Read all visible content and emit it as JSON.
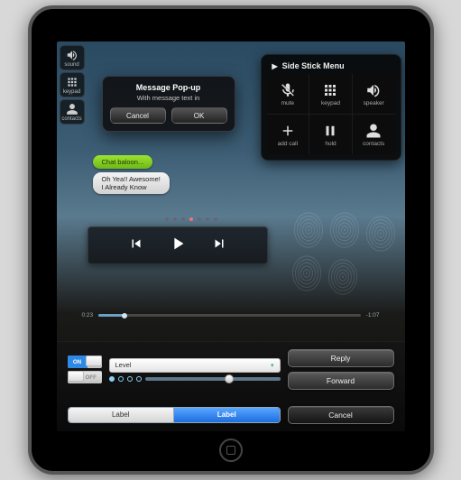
{
  "status": {
    "time": ""
  },
  "sidebar": {
    "items": [
      {
        "label": "sound",
        "icon": "volume-icon"
      },
      {
        "label": "keypad",
        "icon": "keypad-icon"
      },
      {
        "label": "contacts",
        "icon": "person-icon"
      }
    ]
  },
  "menu": {
    "title": "Side Stick Menu",
    "items": [
      {
        "label": "mute",
        "icon": "mic-off-icon"
      },
      {
        "label": "keypad",
        "icon": "keypad-icon"
      },
      {
        "label": "speaker",
        "icon": "volume-icon"
      },
      {
        "label": "add call",
        "icon": "plus-icon"
      },
      {
        "label": "hold",
        "icon": "pause-icon"
      },
      {
        "label": "contacts",
        "icon": "person-icon"
      }
    ]
  },
  "popup": {
    "title": "Message Pop-up",
    "body": "With message text in",
    "cancel": "Cancel",
    "ok": "OK"
  },
  "chat": {
    "green": "Chat baloon...",
    "grey1": "Oh Yea!! Awesome!",
    "grey2": "I Already Know"
  },
  "progress": {
    "elapsed": "0:23",
    "remaining": "-1:07"
  },
  "panel": {
    "toggle_on": "ON",
    "toggle_off": "OFF",
    "select": "Level",
    "reply": "Reply",
    "forward": "Forward",
    "cancel": "Cancel",
    "seg_a": "Label",
    "seg_b": "Label"
  }
}
